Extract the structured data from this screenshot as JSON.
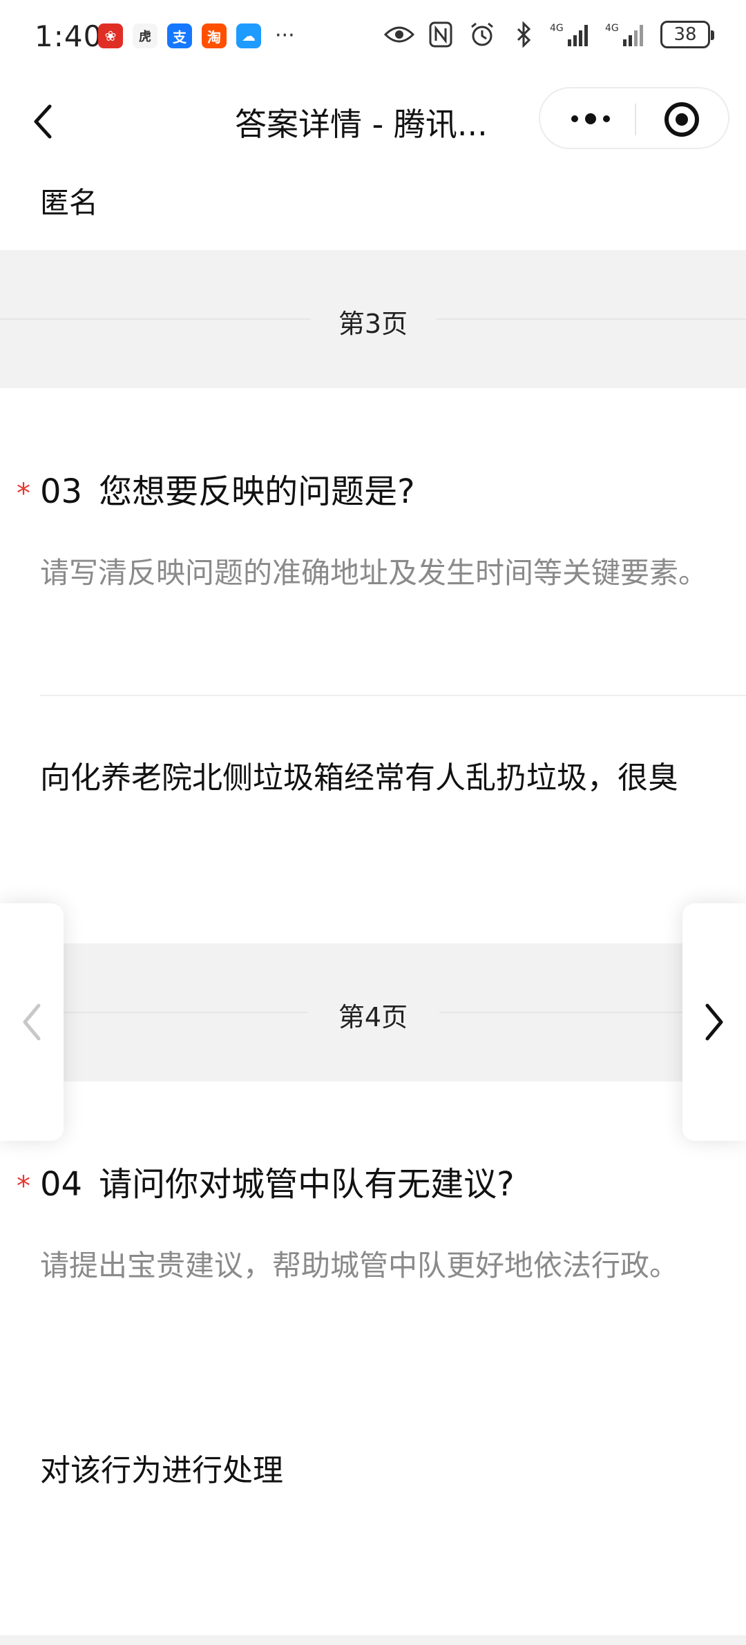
{
  "status_bar": {
    "time": "1:40",
    "apps": [
      {
        "name": "pinduoduo-icon",
        "glyph": "❀",
        "color": "#e02e24"
      },
      {
        "name": "huya-icon",
        "glyph": "虎",
        "color": "#f5f5f5"
      },
      {
        "name": "alipay-icon",
        "glyph": "支",
        "color": "#1677ff"
      },
      {
        "name": "taobao-icon",
        "glyph": "淘",
        "color": "#ff5000"
      },
      {
        "name": "cloud-icon",
        "glyph": "☁",
        "color": "#1e9bff"
      }
    ],
    "more": "···",
    "network_label": "4G",
    "battery": "38"
  },
  "nav": {
    "title": "答案详情 - 腾讯...",
    "back_icon": "chevron-left-icon",
    "more_icon": "more-dots-icon",
    "close_icon": "target-close-icon"
  },
  "content": {
    "prev_answer": "匿名",
    "sections": [
      {
        "page_label": "第3页",
        "number": "03",
        "required_mark": "*",
        "question": "您想要反映的问题是?",
        "description": "请写清反映问题的准确地址及发生时间等关键要素。",
        "answer": "向化养老院北侧垃圾箱经常有人乱扔垃圾，很臭"
      },
      {
        "page_label": "第4页",
        "number": "04",
        "required_mark": "*",
        "question": "请问你对城管中队有无建议?",
        "description": "请提出宝贵建议，帮助城管中队更好地依法行政。",
        "answer": "对该行为进行处理"
      }
    ]
  },
  "pager": {
    "prev_icon": "chevron-left-icon",
    "next_icon": "chevron-right-icon",
    "prev_color": "#c8c8c8",
    "next_color": "#111111"
  }
}
